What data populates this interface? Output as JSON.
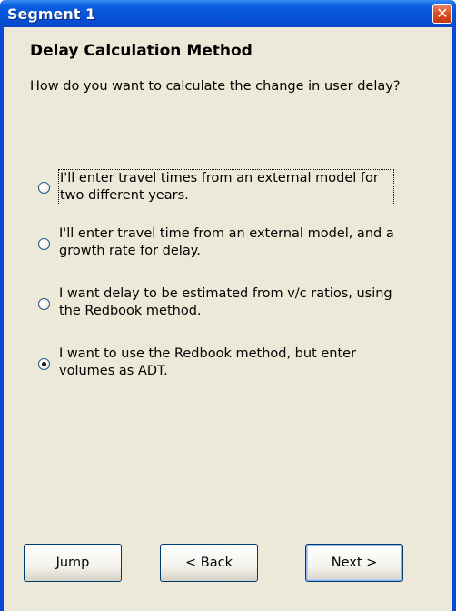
{
  "window": {
    "title": "Segment 1",
    "close_glyph": "✕"
  },
  "heading": "Delay Calculation Method",
  "question": "How do you want to calculate the change in user delay?",
  "options": [
    {
      "label": "I'll enter travel times from an external model for two different years.",
      "selected": false,
      "focused": true
    },
    {
      "label": "I'll enter travel time from an external model, and a growth rate for delay.",
      "selected": false,
      "focused": false
    },
    {
      "label": "I want delay to be estimated from v/c ratios, using the Redbook method.",
      "selected": false,
      "focused": false
    },
    {
      "label": "I want to use the Redbook method, but enter volumes as ADT.",
      "selected": true,
      "focused": false
    }
  ],
  "buttons": {
    "jump": "Jump",
    "back": "< Back",
    "next": "Next >"
  },
  "colors": {
    "title_bar": "#0552d8",
    "dialog_face": "#ece9d8",
    "close_button": "#d8501e"
  }
}
